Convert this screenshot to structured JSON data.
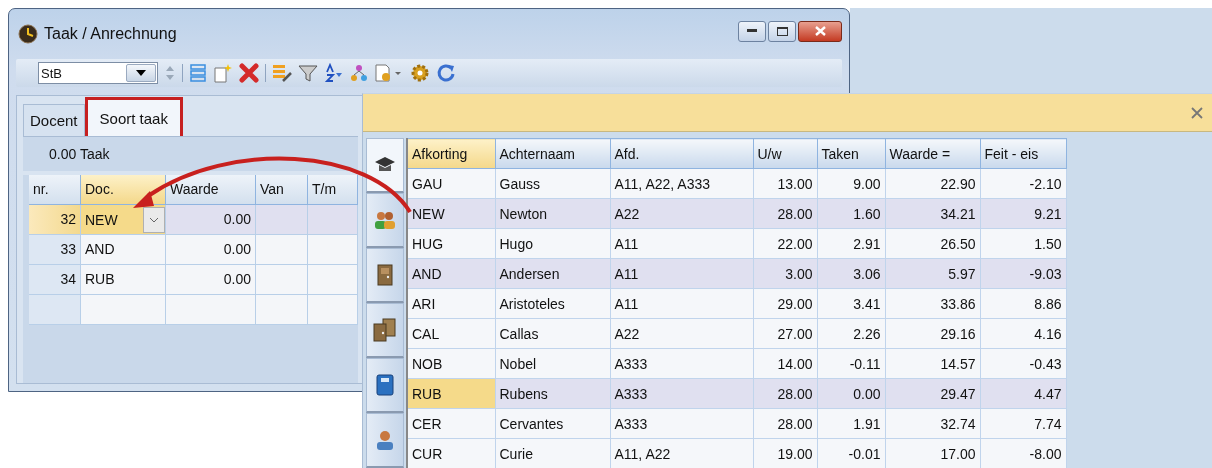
{
  "window": {
    "title": "Taak / Anrechnung"
  },
  "toolbar": {
    "combo_value": "StB"
  },
  "tabs": [
    {
      "label": "Docent",
      "selected": false,
      "annotated": false
    },
    {
      "label": "Soort taak",
      "selected": true,
      "annotated": true
    }
  ],
  "summary": "0.00 Taak",
  "task_table": {
    "columns": [
      "nr.",
      "Doc.",
      "Waarde",
      "Van",
      "T/m"
    ],
    "rows": [
      {
        "nr": "32",
        "doc": "NEW",
        "waarde": "0.00",
        "selected": true
      },
      {
        "nr": "33",
        "doc": "AND",
        "waarde": "0.00",
        "selected": false
      },
      {
        "nr": "34",
        "doc": "RUB",
        "waarde": "0.00",
        "selected": false
      }
    ]
  },
  "panel": {
    "side_tabs": [
      {
        "kind": "cap",
        "selected": true
      },
      {
        "kind": "people",
        "selected": false
      },
      {
        "kind": "door",
        "selected": false
      },
      {
        "kind": "doors",
        "selected": false
      },
      {
        "kind": "book",
        "selected": false
      },
      {
        "kind": "person",
        "selected": false
      }
    ],
    "table": {
      "columns": [
        "Afkorting",
        "Achternaam",
        "Afd.",
        "U/w",
        "Taken",
        "Waarde =",
        "Feit - eis"
      ],
      "rows": [
        {
          "cells": [
            "GAU",
            "Gauss",
            "A11, A22, A333",
            "13.00",
            "9.00",
            "22.90",
            "-2.10"
          ],
          "assigned": false,
          "current": false
        },
        {
          "cells": [
            "NEW",
            "Newton",
            "A22",
            "28.00",
            "1.60",
            "34.21",
            "9.21"
          ],
          "assigned": true,
          "current": false
        },
        {
          "cells": [
            "HUG",
            "Hugo",
            "A11",
            "22.00",
            "2.91",
            "26.50",
            "1.50"
          ],
          "assigned": false,
          "current": false
        },
        {
          "cells": [
            "AND",
            "Andersen",
            "A11",
            "3.00",
            "3.06",
            "5.97",
            "-9.03"
          ],
          "assigned": true,
          "current": false
        },
        {
          "cells": [
            "ARI",
            "Aristoteles",
            "A11",
            "29.00",
            "3.41",
            "33.86",
            "8.86"
          ],
          "assigned": false,
          "current": false
        },
        {
          "cells": [
            "CAL",
            "Callas",
            "A22",
            "27.00",
            "2.26",
            "29.16",
            "4.16"
          ],
          "assigned": false,
          "current": false
        },
        {
          "cells": [
            "NOB",
            "Nobel",
            "A333",
            "14.00",
            "-0.11",
            "14.57",
            "-0.43"
          ],
          "assigned": false,
          "current": false
        },
        {
          "cells": [
            "RUB",
            "Rubens",
            "A333",
            "28.00",
            "0.00",
            "29.47",
            "4.47"
          ],
          "assigned": true,
          "current": true
        },
        {
          "cells": [
            "CER",
            "Cervantes",
            "A333",
            "28.00",
            "1.91",
            "32.74",
            "7.74"
          ],
          "assigned": false,
          "current": false
        },
        {
          "cells": [
            "CUR",
            "Curie",
            "A11, A22",
            "19.00",
            "-0.01",
            "17.00",
            "-8.00"
          ],
          "assigned": false,
          "current": false
        }
      ]
    }
  }
}
